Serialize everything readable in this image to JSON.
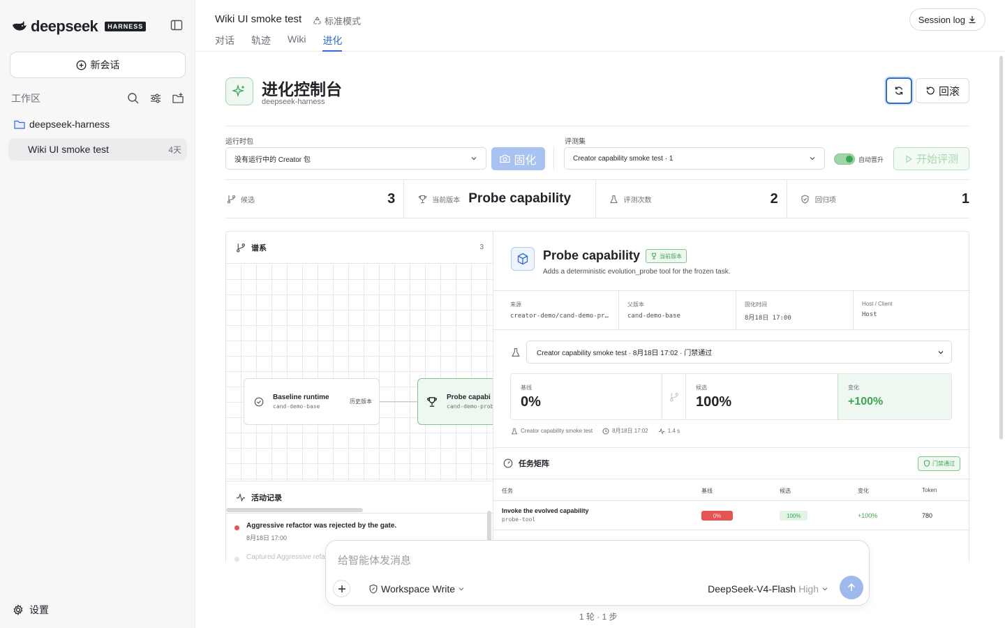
{
  "sidebar": {
    "logo_text": "deepseek",
    "logo_badge": "HARNESS",
    "new_chat": "新会话",
    "workspace_title": "工作区",
    "folder": "deepseek-harness",
    "session_title": "Wiki UI smoke test",
    "session_age": "4天",
    "settings": "设置"
  },
  "header": {
    "title": "Wiki UI smoke test",
    "mode": "标准模式",
    "tabs": [
      "对话",
      "轨迹",
      "Wiki",
      "进化"
    ],
    "active_tab": "进化",
    "session_log": "Session log"
  },
  "console": {
    "title": "进化控制台",
    "subtitle": "deepseek-harness",
    "rollback": "回滚",
    "runtime_label": "运行时包",
    "runtime_value": "没有运行中的 Creator 包",
    "solidify": "固化",
    "evalset_label": "评测集",
    "evalset_value": "Creator capability smoke test · 1",
    "auto_promote": "自动晋升",
    "auto_promote_on": true,
    "start_eval": "开始评测"
  },
  "stats": {
    "candidates_label": "候选",
    "candidates": "3",
    "current_label": "当前版本",
    "current": "Probe capability",
    "evals_label": "评测次数",
    "evals": "2",
    "regressions_label": "回归项",
    "regressions": "1"
  },
  "lineage": {
    "title": "谱系",
    "count": "3",
    "node1_title": "Baseline runtime",
    "node1_sub": "cand-demo-base",
    "node1_badge": "历史版本",
    "node2_title": "Probe capabi",
    "node2_sub": "cand-demo-prob"
  },
  "activity": {
    "title": "活动记录",
    "items": [
      {
        "text": "Aggressive refactor was rejected by the gate.",
        "time": "8月18日 17:00",
        "color": "#e55353"
      },
      {
        "text": "Captured Aggressive refa",
        "time": "",
        "color": "#c9c9cf"
      }
    ]
  },
  "detail": {
    "title": "Probe capability",
    "badge": "当前版本",
    "desc": "Adds a deterministic evolution_probe tool for the frozen task.",
    "meta": [
      {
        "label": "来源",
        "value": "creator-demo/cand-demo-pr…"
      },
      {
        "label": "父版本",
        "value": "cand-demo-base"
      },
      {
        "label": "固化时间",
        "value": "8月18日 17:00"
      },
      {
        "label": "Host / Client",
        "value": "Host"
      }
    ],
    "eval_select": "Creator capability smoke test · 8月18日 17:02 · 门禁通过",
    "baseline_label": "基线",
    "baseline": "0%",
    "candidate_label": "候选",
    "candidate": "100%",
    "delta_label": "变化",
    "delta": "+100%",
    "foot_suite": "Creator capability smoke test",
    "foot_time": "8月18日 17:02",
    "foot_duration": "1.4 s"
  },
  "matrix": {
    "title": "任务矩阵",
    "gate": "门禁通过",
    "headers": [
      "任务",
      "基线",
      "候选",
      "变化",
      "Token"
    ],
    "row": {
      "name": "Invoke the evolved capability",
      "sub": "probe-tool",
      "baseline": "0%",
      "candidate": "100%",
      "delta": "+100%",
      "tokens": "780"
    }
  },
  "composer": {
    "placeholder": "给智能体发消息",
    "permission": "Workspace Write",
    "model": "DeepSeek-V4-Flash",
    "level": "High"
  },
  "footer": "1 轮 · 1 步",
  "colors": {
    "accent": "#2f6bd8",
    "success": "#3aa552",
    "danger": "#e55353"
  }
}
